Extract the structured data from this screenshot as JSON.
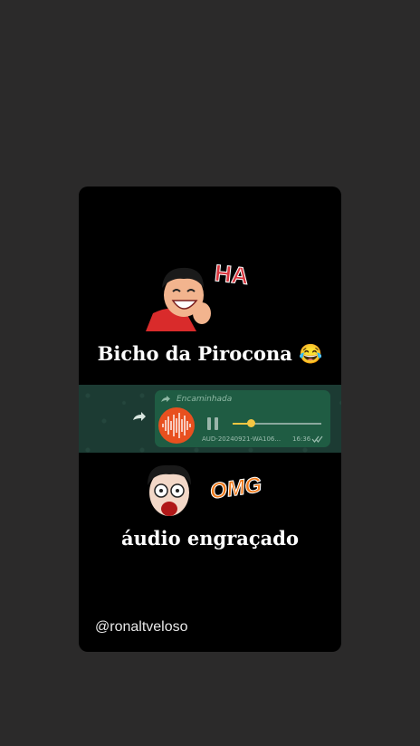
{
  "sticker_top": {
    "text": "HA",
    "color": "#d9343c"
  },
  "caption_top": {
    "text": "Bicho da Pirocona 😂"
  },
  "audio_message": {
    "forwarded_label": "Encaminhada",
    "filename": "AUD-20240921-WA106...",
    "time": "16:36",
    "progress": 0.2,
    "accent": "#f4c542",
    "bubble_color": "#1f5c43",
    "avatar_color": "#e8501f"
  },
  "sticker_bottom": {
    "text": "OMG",
    "color": "#f07a1a"
  },
  "caption_bottom": {
    "text": "áudio engraçado"
  },
  "watermark": {
    "text": "@ronaltveloso"
  }
}
